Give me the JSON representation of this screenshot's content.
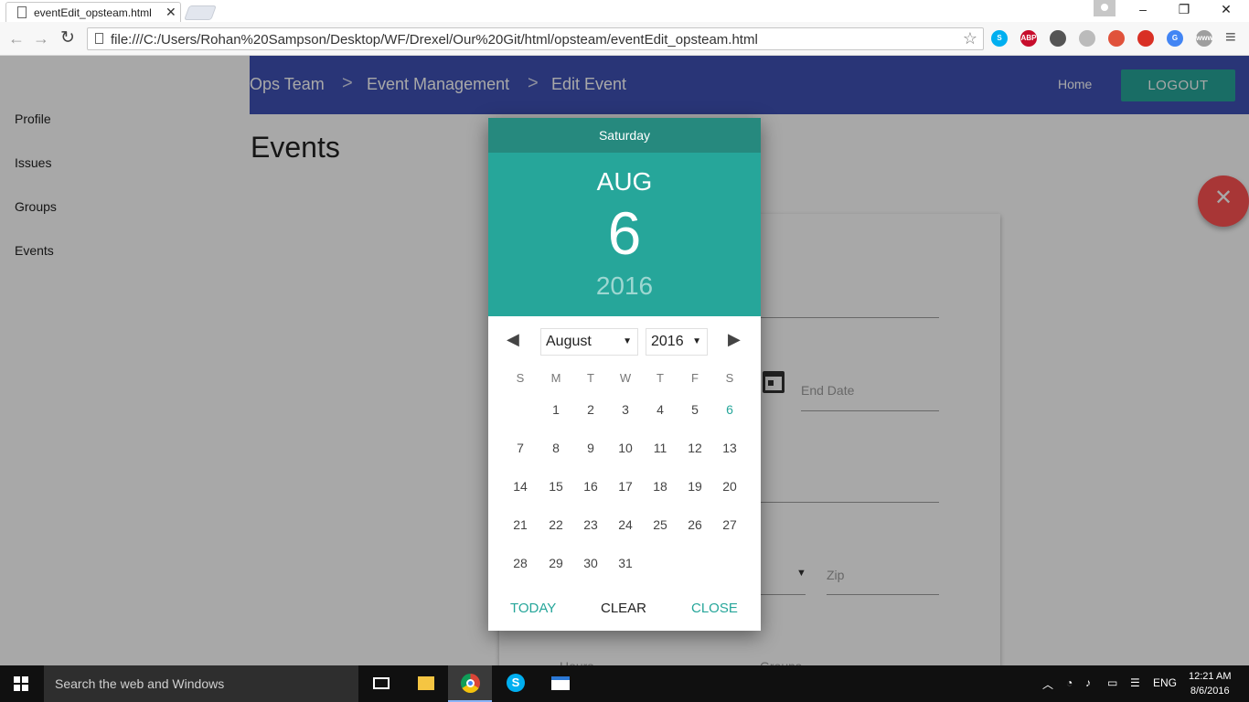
{
  "browser": {
    "tab_title": "eventEdit_opsteam.html",
    "tab_close": "✕",
    "url": "file:///C:/Users/Rohan%20Sampson/Desktop/WF/Drexel/Our%20Git/html/opsteam/eventEdit_opsteam.html",
    "window_controls": [
      "–",
      "❐",
      "✕"
    ],
    "extensions": [
      {
        "name": "skype-icon",
        "label": "S",
        "color": "#00aff0"
      },
      {
        "name": "adblock-icon",
        "label": "ABP",
        "color": "#c70d2c"
      },
      {
        "name": "bulb-icon",
        "label": "",
        "color": "#555555"
      },
      {
        "name": "refresh-ext-icon",
        "label": "",
        "color": "#bbbbbb"
      },
      {
        "name": "block-ext-icon",
        "label": "",
        "color": "#e0523b"
      },
      {
        "name": "record-ext-icon",
        "label": "",
        "color": "#d93025"
      },
      {
        "name": "translate-icon",
        "label": "G",
        "color": "#4285f4"
      },
      {
        "name": "www-ext-icon",
        "label": "www",
        "color": "#9e9e9e"
      }
    ]
  },
  "sidebar": {
    "items": [
      {
        "label": "Profile"
      },
      {
        "label": "Issues"
      },
      {
        "label": "Groups"
      },
      {
        "label": "Events"
      }
    ]
  },
  "navbar": {
    "breadcrumbs": [
      "Ops Team",
      "Event Management",
      "Edit Event"
    ],
    "separator": ">",
    "home": "Home",
    "logout": "LOGOUT"
  },
  "main": {
    "title": "Events",
    "end_date_placeholder": "End Date",
    "zip_placeholder": "Zip",
    "hours_label": "Hours",
    "groups_label": "Groups",
    "fab_icon": "✕"
  },
  "datepicker": {
    "weekday": "Saturday",
    "month_short": "AUG",
    "day": "6",
    "year": "2016",
    "month_select": "August",
    "year_select": "2016",
    "days_of_week": [
      "S",
      "M",
      "T",
      "W",
      "T",
      "F",
      "S"
    ],
    "weeks": [
      [
        "",
        "1",
        "2",
        "3",
        "4",
        "5",
        "6"
      ],
      [
        "7",
        "8",
        "9",
        "10",
        "11",
        "12",
        "13"
      ],
      [
        "14",
        "15",
        "16",
        "17",
        "18",
        "19",
        "20"
      ],
      [
        "21",
        "22",
        "23",
        "24",
        "25",
        "26",
        "27"
      ],
      [
        "28",
        "29",
        "30",
        "31",
        "",
        "",
        ""
      ]
    ],
    "selected": "6",
    "today_label": "TODAY",
    "clear_label": "CLEAR",
    "close_label": "CLOSE",
    "accent_color": "#26a69a"
  },
  "taskbar": {
    "search_placeholder": "Search the web and Windows",
    "language": "ENG",
    "time": "12:21 AM",
    "date": "8/6/2016"
  }
}
